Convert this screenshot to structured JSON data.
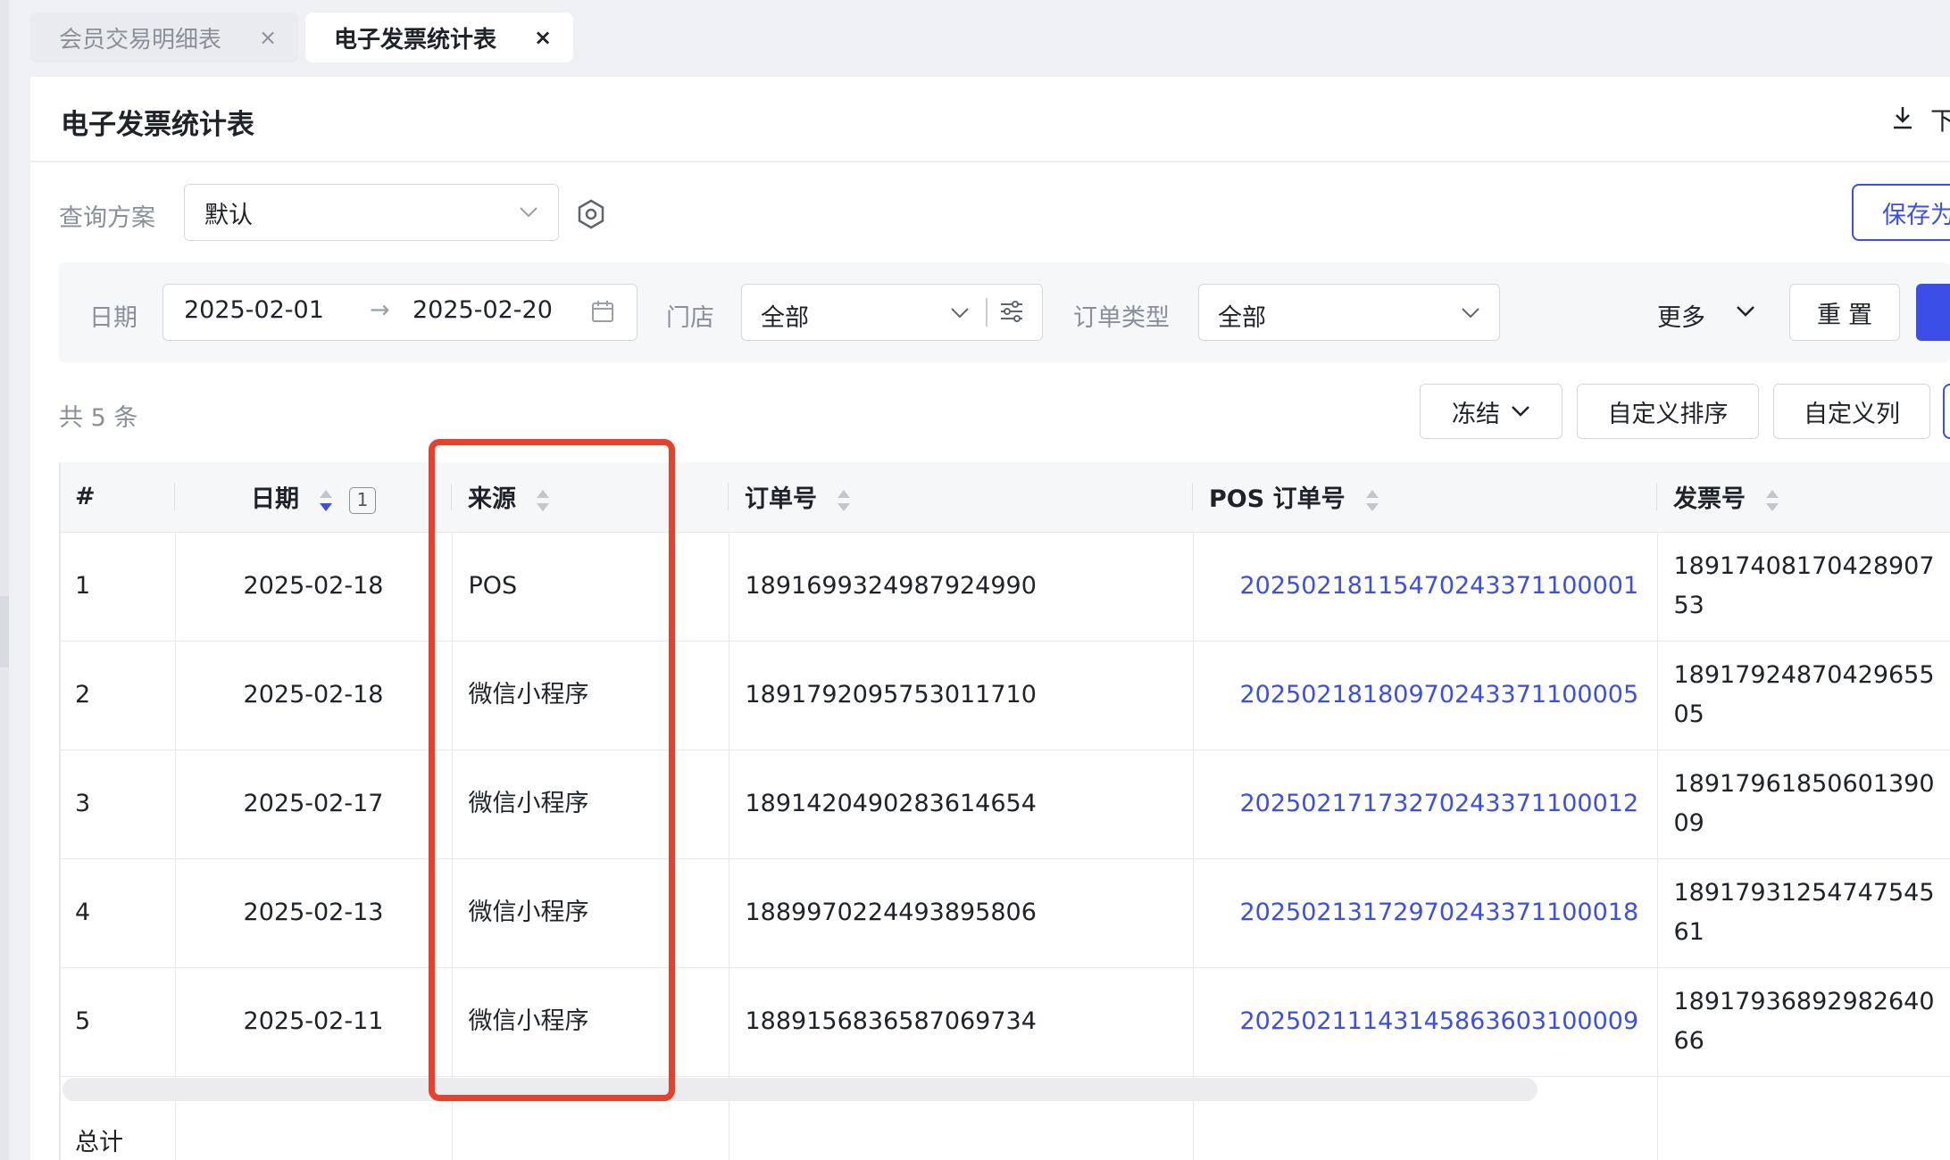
{
  "tabs": [
    {
      "label": "会员交易明细表",
      "close": "×"
    },
    {
      "label": "电子发票统计表",
      "close": "×"
    }
  ],
  "page": {
    "title": "电子发票统计表",
    "download_label": "下"
  },
  "scheme": {
    "label": "查询方案",
    "value": "默认",
    "save_label": "保存为"
  },
  "filters": {
    "date_label": "日期",
    "date_start": "2025-02-01",
    "date_arrow": "→",
    "date_end": "2025-02-20",
    "store_label": "门店",
    "store_value": "全部",
    "order_type_label": "订单类型",
    "order_type_value": "全部",
    "more_label": "更多",
    "reset_label": "重置"
  },
  "toolbar": {
    "count_text": "共 5 条",
    "freeze_label": "冻结",
    "custom_sort_label": "自定义排序",
    "custom_cols_label": "自定义列"
  },
  "table": {
    "headers": {
      "index": "#",
      "date": "日期",
      "date_sort_badge": "1",
      "source": "来源",
      "order_no": "订单号",
      "pos_order_no": "POS 订单号",
      "invoice_no": "发票号"
    },
    "rows": [
      {
        "index": "1",
        "date": "2025-02-18",
        "source": "POS",
        "order_no": "1891699324987924990",
        "pos_order_no": "20250218115470243371100001",
        "invoice_no": "1891740817042890753"
      },
      {
        "index": "2",
        "date": "2025-02-18",
        "source": "微信小程序",
        "order_no": "1891792095753011710",
        "pos_order_no": "20250218180970243371100005",
        "invoice_no": "1891792487042965505"
      },
      {
        "index": "3",
        "date": "2025-02-17",
        "source": "微信小程序",
        "order_no": "1891420490283614654",
        "pos_order_no": "20250217173270243371100012",
        "invoice_no": "1891796185060139009"
      },
      {
        "index": "4",
        "date": "2025-02-13",
        "source": "微信小程序",
        "order_no": "1889970224493895806",
        "pos_order_no": "20250213172970243371100018",
        "invoice_no": "1891793125474754561"
      },
      {
        "index": "5",
        "date": "2025-02-11",
        "source": "微信小程序",
        "order_no": "1889156836587069734",
        "pos_order_no": "20250211143145863603100009",
        "invoice_no": "1891793689298264066"
      }
    ],
    "total_label": "总计"
  },
  "colors": {
    "accent": "#3b4ee8",
    "highlight": "#e5412d"
  },
  "icons": [
    "close-icon",
    "download-icon",
    "chevron-down-icon",
    "settings-icon",
    "calendar-icon",
    "sliders-icon",
    "sort-icon"
  ]
}
